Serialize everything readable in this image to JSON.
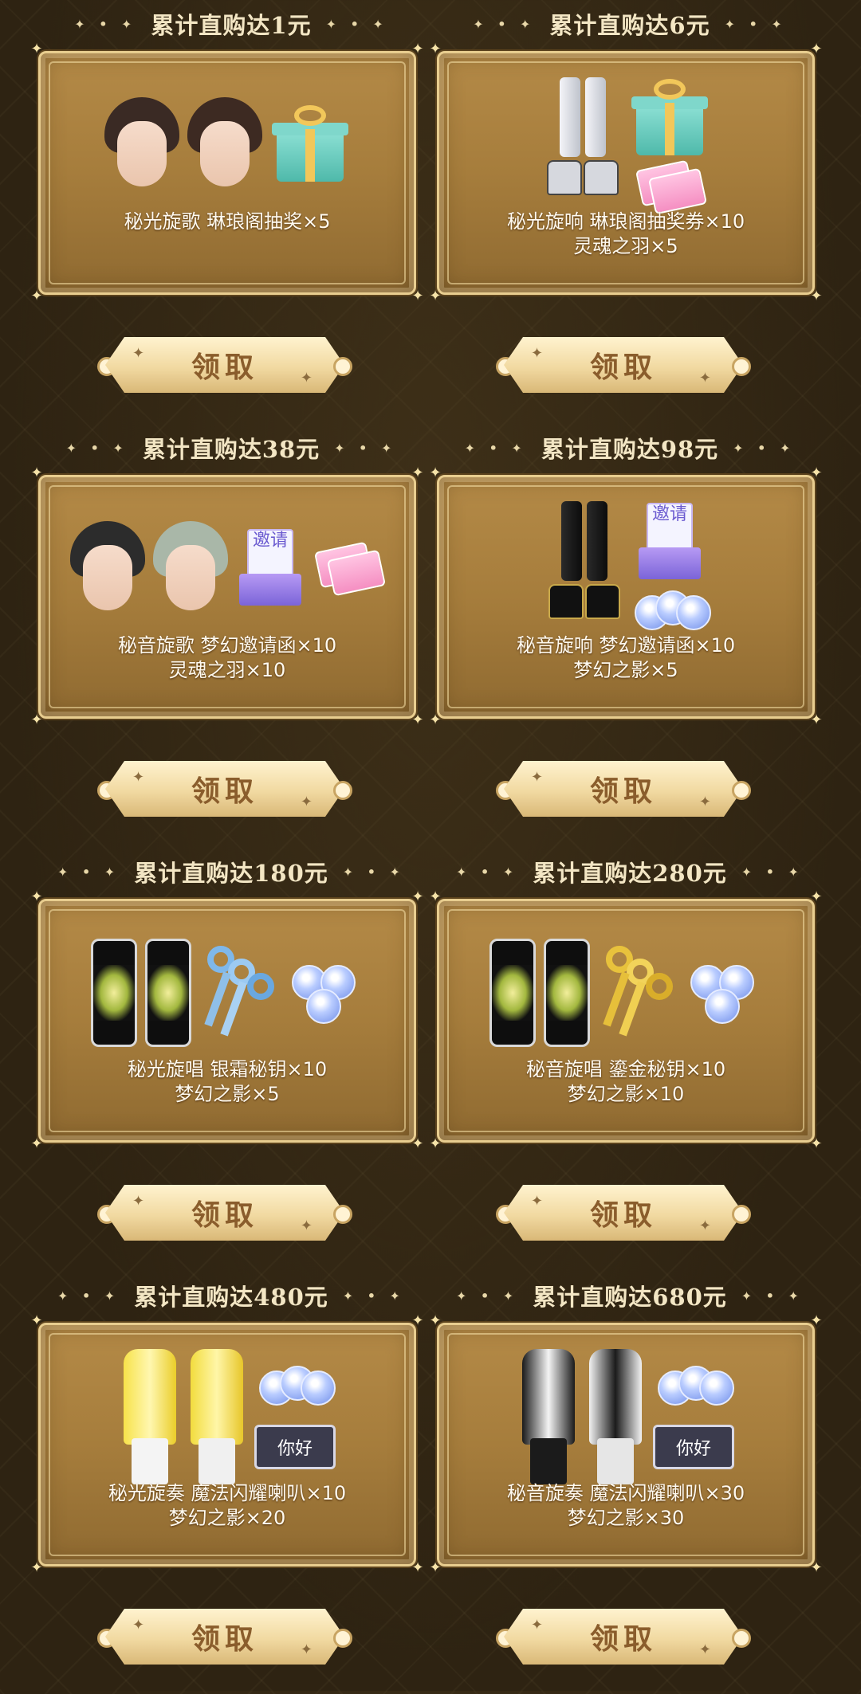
{
  "tiers": [
    {
      "title": "累计直购达1元",
      "line1": "秘光旋歌 琳琅阁抽奖×5",
      "line2": "",
      "button": "领取"
    },
    {
      "title": "累计直购达6元",
      "line1": "秘光旋响 琳琅阁抽奖券×10",
      "line2": "灵魂之羽×5",
      "button": "领取"
    },
    {
      "title": "累计直购达38元",
      "line1": "秘音旋歌 梦幻邀请函×10",
      "line2": "灵魂之羽×10",
      "button": "领取"
    },
    {
      "title": "累计直购达98元",
      "line1": "秘音旋响 梦幻邀请函×10",
      "line2": "梦幻之影×5",
      "button": "领取"
    },
    {
      "title": "累计直购达180元",
      "line1": "秘光旋唱 银霜秘钥×10",
      "line2": "梦幻之影×5",
      "button": "领取"
    },
    {
      "title": "累计直购达280元",
      "line1": "秘音旋唱 鎏金秘钥×10",
      "line2": "梦幻之影×10",
      "button": "领取"
    },
    {
      "title": "累计直购达480元",
      "line1": "秘光旋奏 魔法闪耀喇叭×10",
      "line2": "梦幻之影×20",
      "button": "领取"
    },
    {
      "title": "累计直购达680元",
      "line1": "秘音旋奏 魔法闪耀喇叭×30",
      "line2": "梦幻之影×30",
      "button": "领取"
    }
  ],
  "invite_text": "邀请",
  "horn_plate_text": "你好",
  "colors": {
    "panel_gold": "#a67d3c",
    "button_text": "#8a5d2c",
    "title_text": "#f3e6c4",
    "background": "#2e2312"
  }
}
